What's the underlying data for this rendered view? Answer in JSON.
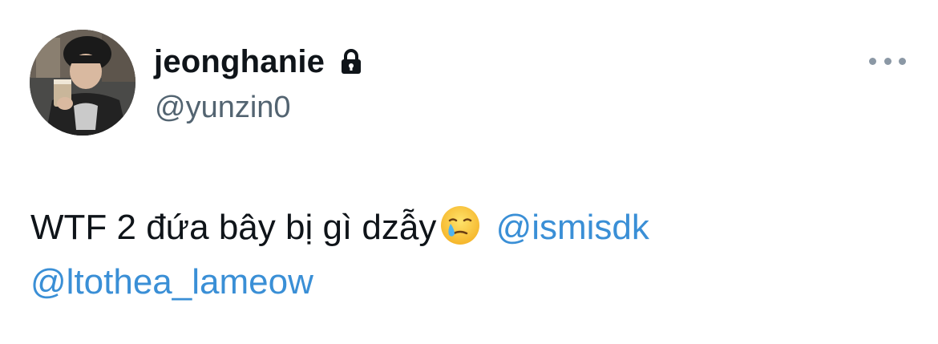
{
  "author": {
    "display_name": "jeonghanie",
    "handle": "@yunzin0",
    "protected_icon": "lock-icon",
    "avatar_icon": "avatar-photo"
  },
  "menu": {
    "icon": "more-horizontal-icon"
  },
  "tweet": {
    "text": "WTF 2 đứa bây bị gì dzẫy",
    "emoji": "face-holding-back-tears",
    "mentions": [
      "@ismisdk",
      "@ltothea_lameow"
    ]
  },
  "colors": {
    "text_primary": "#0f1419",
    "text_secondary": "#536471",
    "link": "#3a8fd6",
    "background": "#ffffff"
  }
}
